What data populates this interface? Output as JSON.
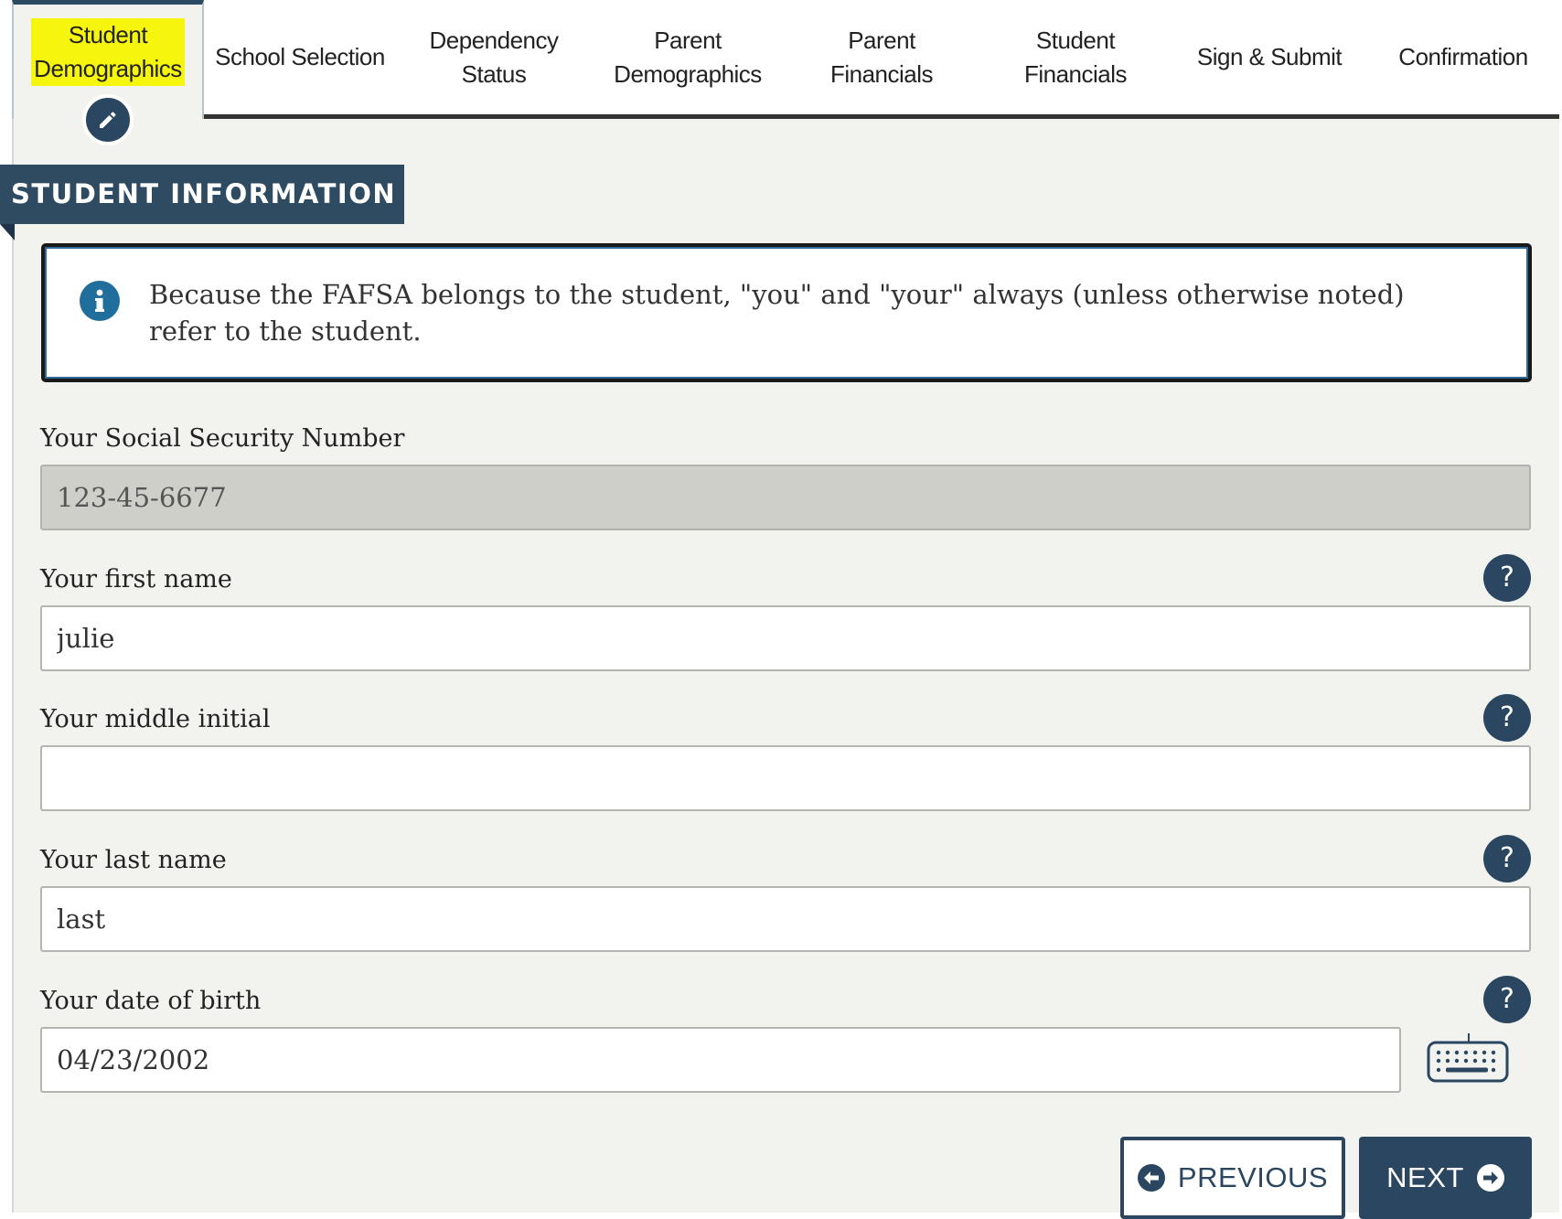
{
  "tabs": [
    {
      "line1": "Student",
      "line2": "Demographics",
      "active": true
    },
    {
      "line1": "School Selection",
      "line2": ""
    },
    {
      "line1": "Dependency",
      "line2": "Status"
    },
    {
      "line1": "Parent",
      "line2": "Demographics"
    },
    {
      "line1": "Parent",
      "line2": "Financials"
    },
    {
      "line1": "Student",
      "line2": "Financials"
    },
    {
      "line1": "Sign & Submit",
      "line2": ""
    },
    {
      "line1": "Confirmation",
      "line2": ""
    }
  ],
  "active_tab_badge_icon": "pencil-icon",
  "section": {
    "title": "STUDENT INFORMATION"
  },
  "info": {
    "icon": "info-icon",
    "text": "Because the FAFSA belongs to the student, \"you\" and \"your\" always (unless otherwise noted) refer to the student."
  },
  "fields": {
    "ssn": {
      "label": "Your Social Security Number",
      "value": "123-45-6677",
      "disabled": true
    },
    "first_name": {
      "label": "Your first name",
      "value": "julie"
    },
    "middle_initial": {
      "label": "Your middle initial",
      "value": ""
    },
    "last_name": {
      "label": "Your last name",
      "value": "last"
    },
    "dob": {
      "label": "Your date of birth",
      "value": "04/23/2002"
    }
  },
  "help_icon_text": "?",
  "buttons": {
    "previous": "PREVIOUS",
    "next": "NEXT"
  },
  "colors": {
    "primary": "#2b4660",
    "highlight": "#f5f50e",
    "panel_bg": "#f2f2ef",
    "info_icon": "#1f6e9b"
  }
}
